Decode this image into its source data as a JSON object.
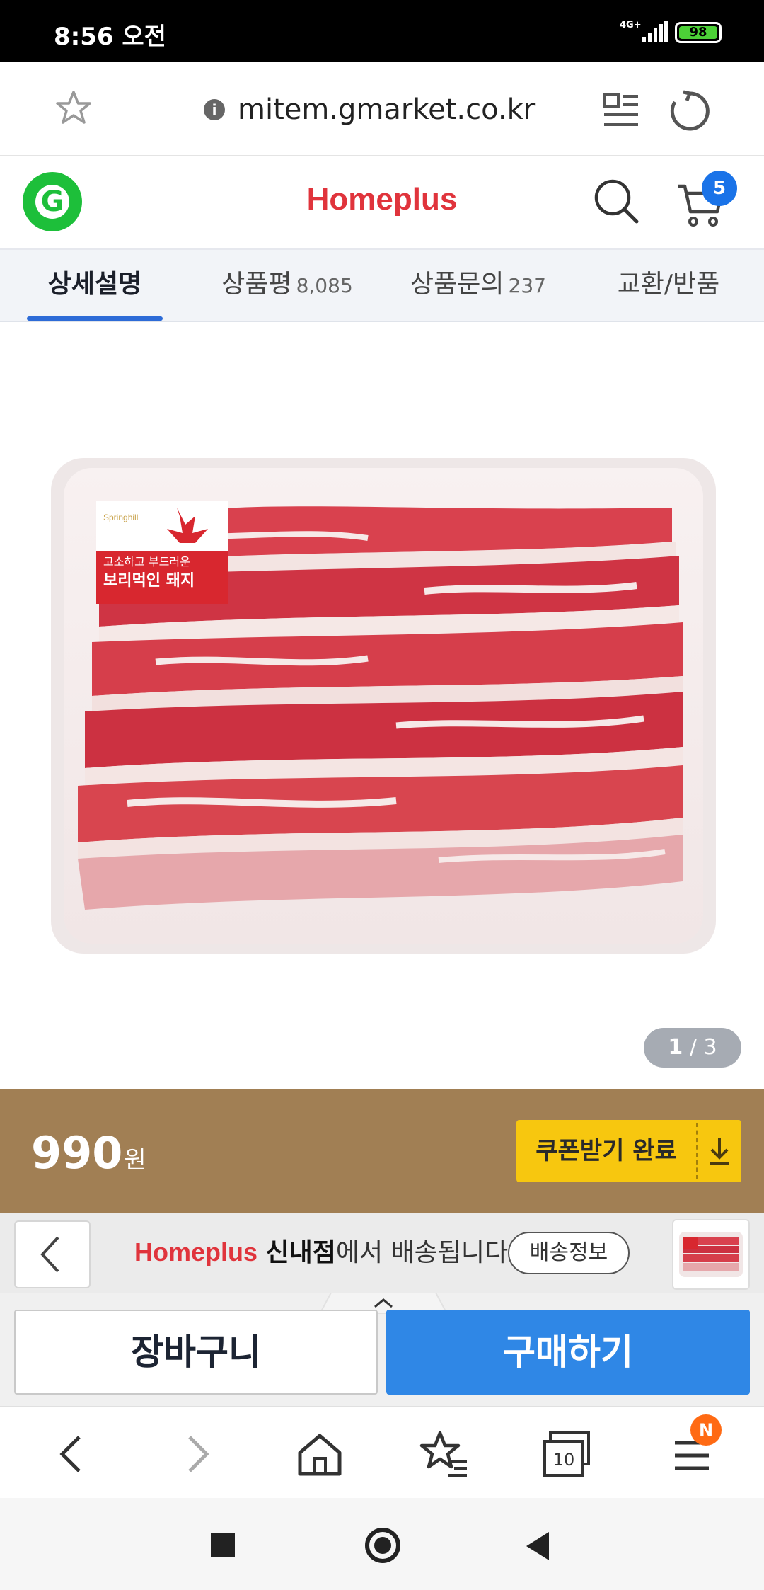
{
  "status_bar": {
    "time": "8:56 오전",
    "network": "4G+",
    "battery": "98"
  },
  "browser": {
    "url": "mitem.gmarket.co.kr"
  },
  "site_header": {
    "brand": "Homeplus",
    "cart_count": "5"
  },
  "tabs": [
    {
      "label": "상세설명",
      "count": ""
    },
    {
      "label": "상품평",
      "count": "8,085"
    },
    {
      "label": "상품문의",
      "count": "237"
    },
    {
      "label": "교환/반품",
      "count": ""
    }
  ],
  "product_image": {
    "package_label_line1": "고소하고 부드러운",
    "package_label_line2": "보리먹인 돼지",
    "package_brand": "Springhill"
  },
  "pager": {
    "current": "1",
    "separator": "/",
    "total": "3"
  },
  "price": {
    "amount": "990",
    "unit": "원"
  },
  "coupon": {
    "label": "쿠폰받기 완료"
  },
  "delivery": {
    "store_brand": "Homeplus",
    "store_name": "신내점",
    "suffix": "에서 배송됩니다",
    "info_button": "배송정보"
  },
  "actions": {
    "cart_label": "장바구니",
    "buy_label": "구매하기"
  },
  "browser_nav": {
    "tabs_count": "10",
    "notification_badge": "N"
  },
  "colors": {
    "brand_red": "#e0343c",
    "gmarket_green": "#1dbf3a",
    "buy_blue": "#2f87e6",
    "coupon_yellow": "#f7c70f",
    "price_banner": "#a17f54"
  }
}
